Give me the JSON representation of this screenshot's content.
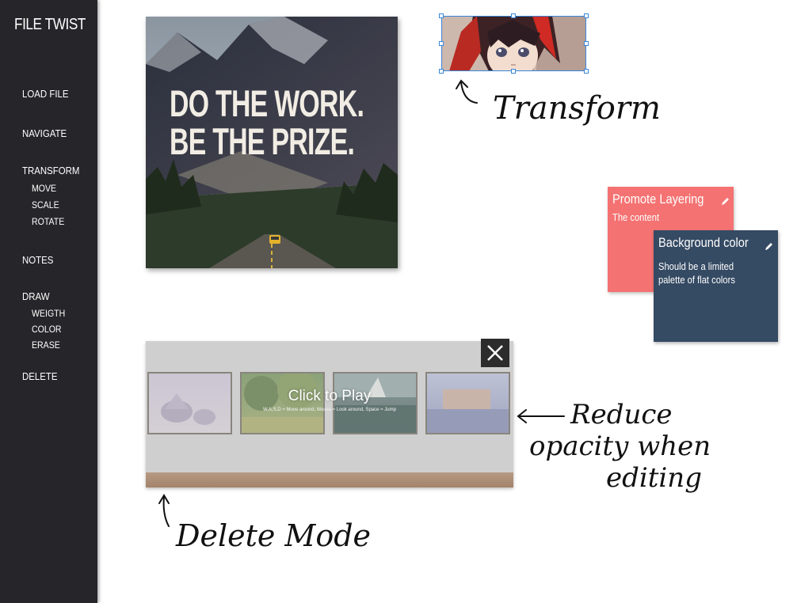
{
  "app": {
    "title": "FILE TWIST"
  },
  "sidebar": {
    "items": [
      {
        "label": "LOAD FILE"
      },
      {
        "label": "NAVIGATE"
      },
      {
        "label": "TRANSFORM",
        "sub": [
          "MOVE",
          "SCALE",
          "ROTATE"
        ]
      },
      {
        "label": "NOTES"
      },
      {
        "label": "DRAW",
        "sub": [
          "WEIGTH",
          "COLOR",
          "ERASE"
        ]
      },
      {
        "label": "DELETE"
      }
    ]
  },
  "poster": {
    "line1": "DO THE WORK.",
    "line2": "BE THE PRIZE."
  },
  "notes": [
    {
      "title": "Promote Layering",
      "body": "The content",
      "color": "#f47272"
    },
    {
      "title": "Background color",
      "body_line1": "Should be a limited",
      "body_line2": "palette of flat colors",
      "color": "#354a63"
    }
  ],
  "gallery": {
    "play_label": "Click to Play",
    "controls_hint": "W,A,S,D = Move around, Mouse = Look around, Space = Jump"
  },
  "annotations": {
    "transform": "Transform",
    "reduce_line1": "Reduce",
    "reduce_line2": "opacity when",
    "reduce_line3": "editing",
    "delete_mode": "Delete Mode"
  },
  "icons": {
    "edit": "pencil-icon",
    "close": "close-icon"
  }
}
